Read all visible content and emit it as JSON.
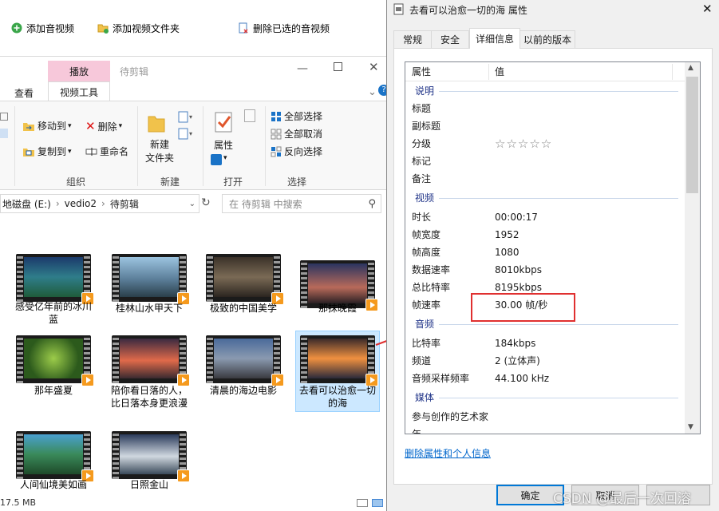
{
  "toolbar": {
    "add_video": "添加音视频",
    "add_folder": "添加视频文件夹",
    "remove_selected": "删除已选的音视频"
  },
  "explorer": {
    "tab_play": "播放",
    "tab_pending": "待剪辑",
    "tab_view": "查看",
    "tab_video_tools": "视频工具",
    "ribbon": {
      "move_to": "移动到",
      "copy_to": "复制到",
      "delete": "删除",
      "rename": "重命名",
      "new_folder": "新建\n文件夹",
      "properties": "属性",
      "select_all": "全部选择",
      "select_none": "全部取消",
      "invert_selection": "反向选择",
      "group_organize": "组织",
      "group_new": "新建",
      "group_open": "打开",
      "group_select": "选择"
    },
    "address": {
      "disk": "地磁盘 (E:)",
      "folder1": "vedio2",
      "folder2": "待剪辑",
      "search_placeholder": "在 待剪辑 中搜索"
    },
    "files": [
      {
        "name": "感受亿年前的冰川蓝"
      },
      {
        "name": "桂林山水甲天下"
      },
      {
        "name": "极致的中国美学"
      },
      {
        "name": "那抹晚霞"
      },
      {
        "name": "那年盛夏"
      },
      {
        "name": "陪你看日落的人，比日落本身更浪漫"
      },
      {
        "name": "清晨的海边电影"
      },
      {
        "name": "去看可以治愈一切的海"
      },
      {
        "name": "人间仙境美如画"
      },
      {
        "name": "日照金山"
      }
    ],
    "status": "17.5 MB"
  },
  "dialog": {
    "title": "去看可以治愈一切的海 属性",
    "tabs": [
      "常规",
      "安全",
      "详细信息",
      "以前的版本"
    ],
    "col_property": "属性",
    "col_value": "值",
    "sections": {
      "description": "说明",
      "video": "视频",
      "audio": "音频",
      "media": "媒体"
    },
    "desc_rows": [
      {
        "k": "标题",
        "v": ""
      },
      {
        "k": "副标题",
        "v": ""
      },
      {
        "k": "分级",
        "v": "☆☆☆☆☆"
      },
      {
        "k": "标记",
        "v": ""
      },
      {
        "k": "备注",
        "v": ""
      }
    ],
    "video_rows": [
      {
        "k": "时长",
        "v": "00:00:17"
      },
      {
        "k": "帧宽度",
        "v": "1952"
      },
      {
        "k": "帧高度",
        "v": "1080"
      },
      {
        "k": "数据速率",
        "v": "8010kbps"
      },
      {
        "k": "总比特率",
        "v": "8195kbps"
      },
      {
        "k": "帧速率",
        "v": "30.00 帧/秒"
      }
    ],
    "audio_rows": [
      {
        "k": "比特率",
        "v": "184kbps"
      },
      {
        "k": "频道",
        "v": "2 (立体声)"
      },
      {
        "k": "音频采样频率",
        "v": "44.100 kHz"
      }
    ],
    "media_rows": [
      {
        "k": "参与创作的艺术家",
        "v": ""
      },
      {
        "k": "年",
        "v": ""
      }
    ],
    "remove_link": "删除属性和个人信息",
    "ok": "确定",
    "cancel": "取消",
    "watermark": "CSDN @最后一次回溶"
  },
  "colors": {
    "highlight_box": "#e03030",
    "link": "#0066cc",
    "section": "#1e3287",
    "tab_play_bg": "#f7c8da"
  }
}
